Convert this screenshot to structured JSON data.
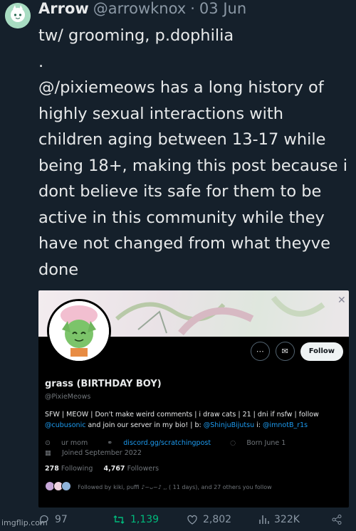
{
  "tweet": {
    "display_name": "Arrow",
    "handle": "@arrowknox",
    "separator": "·",
    "date": "03 Jun",
    "text": "tw/ grooming, p.dophilia\n.\n@/pixiemeows has a long history of highly sexual interactions with children aging between 13-17 while being 18+,  making this post because i dont believe its safe for them to be active in this community while they have not changed from what theyve done"
  },
  "embed": {
    "follow_label": "Follow",
    "more_icon": "more-icon",
    "message_icon": "message-icon",
    "name": "grass (BIRTHDAY BOY)",
    "handle": "@PixieMeows",
    "bio_line1": "SFW | MEOW | Don't make weird comments | i draw cats | 21 | dni if nsfw | follow",
    "bio_link1": "@cubusonic",
    "bio_mid": " and join our server in my bio! | b: ",
    "bio_link2": "@ShinjuBijutsu",
    "bio_mid2": " i: ",
    "bio_link3": "@imnotB_r1s",
    "location": "ur mom",
    "website": "discord.gg/scratchingpost",
    "birthday": "Born June 1",
    "joined": "Joined September 2022",
    "following_count": "278",
    "following_label": "Following",
    "followers_count": "4,767",
    "followers_label": "Followers",
    "followed_by": "Followed by kiki, puffi ♪~ᴗ~♪ ,, ( 11 days), and 27 others you follow"
  },
  "actions": {
    "replies": "97",
    "retweets": "1,139",
    "likes": "2,802",
    "views": "322K"
  },
  "watermark": "imgflip.com",
  "colors": {
    "accent": "#1d9bf0",
    "retweet": "#00ba7c",
    "background": "#15202b"
  }
}
